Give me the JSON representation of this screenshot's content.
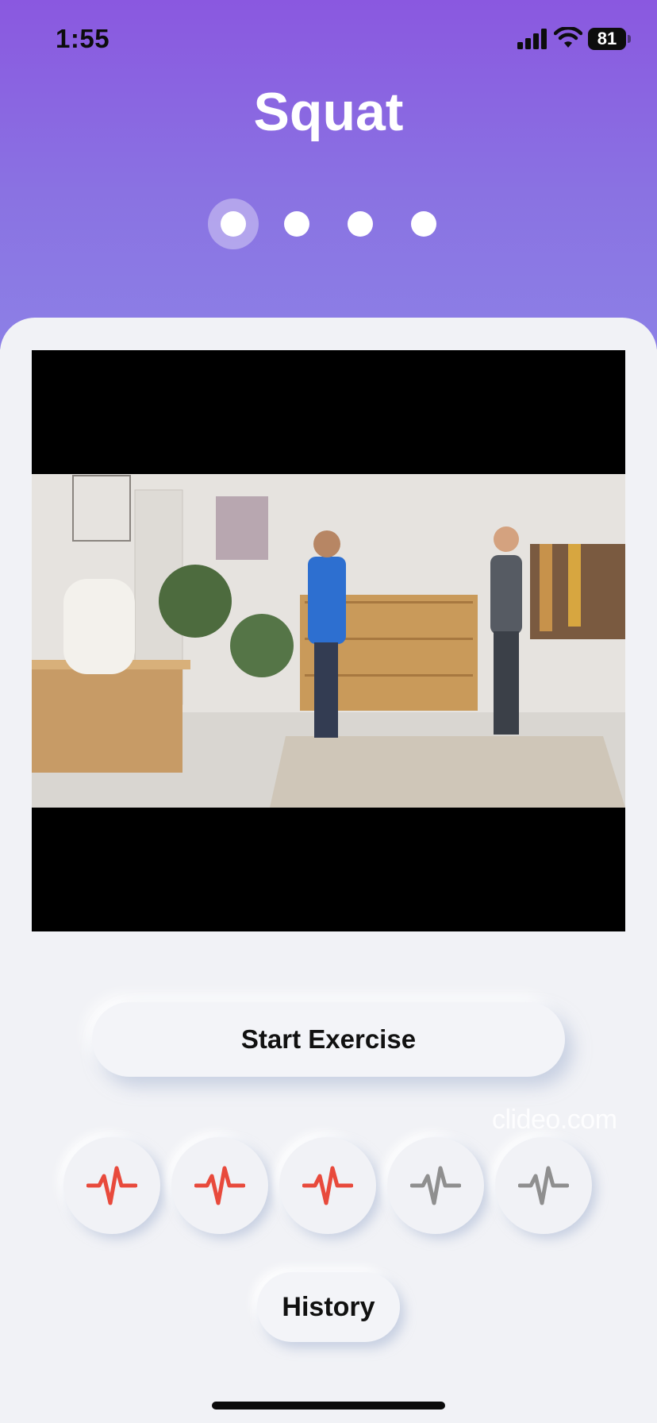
{
  "status_bar": {
    "time": "1:55",
    "battery": "81"
  },
  "header": {
    "title": "Squat"
  },
  "pager": {
    "count": 4,
    "active_index": 0
  },
  "video": {
    "watermark": "clideo.com"
  },
  "actions": {
    "start_label": "Start Exercise",
    "history_label": "History"
  },
  "heart_rate_icons": [
    {
      "icon": "heartbeat-icon",
      "color": "#e84a3c",
      "active": true
    },
    {
      "icon": "heartbeat-icon",
      "color": "#e84a3c",
      "active": true
    },
    {
      "icon": "heartbeat-icon",
      "color": "#e84a3c",
      "active": true
    },
    {
      "icon": "heartbeat-icon",
      "color": "#8f8f8f",
      "active": false
    },
    {
      "icon": "heartbeat-icon",
      "color": "#8f8f8f",
      "active": false
    }
  ],
  "colors": {
    "header_top": "#8a58e0",
    "header_bottom": "#8c80e6",
    "background": "#f1f2f6",
    "active_pulse": "#e84a3c",
    "inactive_pulse": "#8f8f8f"
  }
}
